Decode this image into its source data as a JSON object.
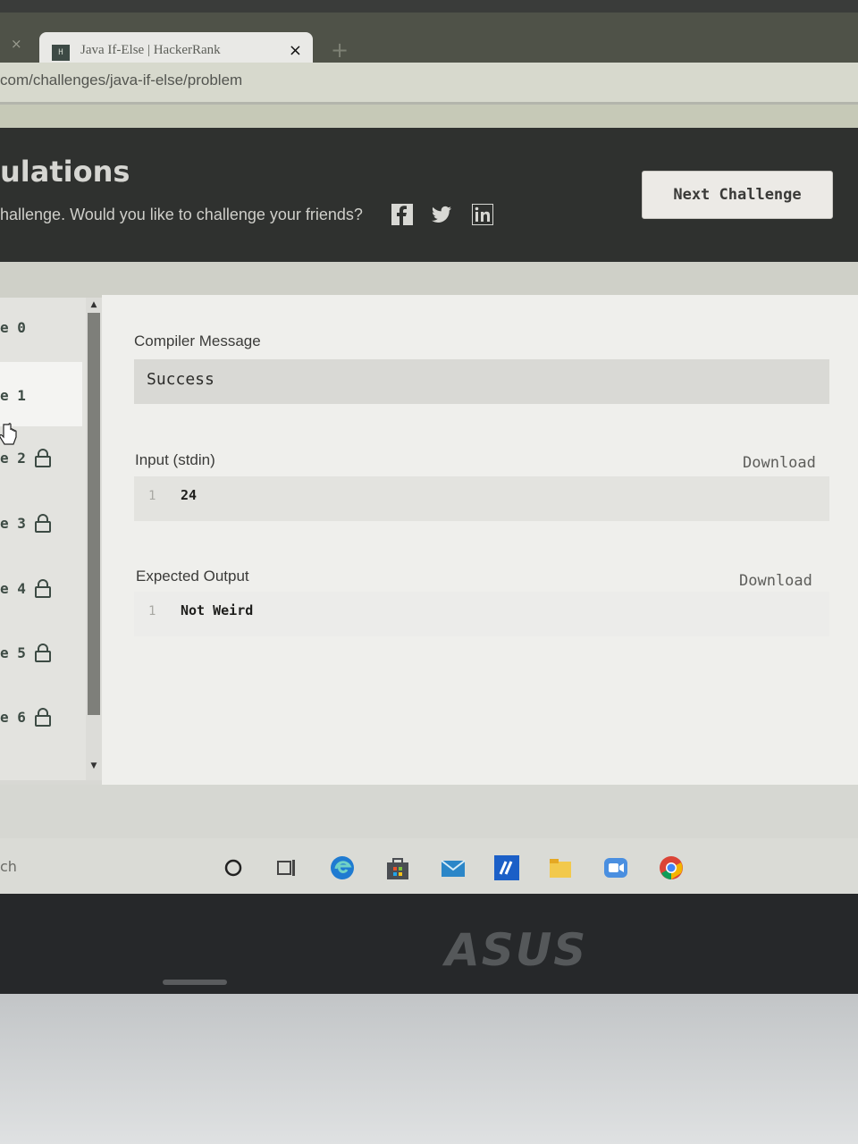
{
  "browser": {
    "tab_title": "Java If-Else | HackerRank",
    "favicon_text": "H",
    "tab_close": "×",
    "prev_tab_close": "×",
    "new_tab": "+",
    "url": "com/challenges/java-if-else/problem"
  },
  "banner": {
    "title": "ulations",
    "text": "hallenge. Would you like to challenge your friends?",
    "social_icons": [
      "facebook-icon",
      "twitter-icon",
      "linkedin-icon"
    ],
    "next_button": "Next Challenge"
  },
  "sidebar": {
    "cases": [
      {
        "label": "e 0",
        "locked": false,
        "active": false
      },
      {
        "label": "e 1",
        "locked": false,
        "active": true
      },
      {
        "label": "e 2",
        "locked": true,
        "active": false
      },
      {
        "label": "e 3",
        "locked": true,
        "active": false
      },
      {
        "label": "e 4",
        "locked": true,
        "active": false
      },
      {
        "label": "e 5",
        "locked": true,
        "active": false
      },
      {
        "label": "e 6",
        "locked": true,
        "active": false
      }
    ]
  },
  "result": {
    "compiler_label": "Compiler Message",
    "compiler_message": "Success",
    "input_label": "Input (stdin)",
    "input_line_number": "1",
    "input_value": "24",
    "expected_label": "Expected Output",
    "expected_line_number": "1",
    "expected_value": "Not Weird",
    "download_label": "Download"
  },
  "taskbar": {
    "search_text": "ch",
    "icons": [
      "cortana-icon",
      "task-view-icon",
      "edge-icon",
      "store-icon",
      "mail-icon",
      "app-icon",
      "explorer-icon",
      "zoom-icon",
      "chrome-icon"
    ]
  },
  "laptop": {
    "brand": "ASUS"
  },
  "colors": {
    "banner_bg": "#2f312f",
    "accent_text": "#3d4b44",
    "panel_bg": "#efefec"
  }
}
